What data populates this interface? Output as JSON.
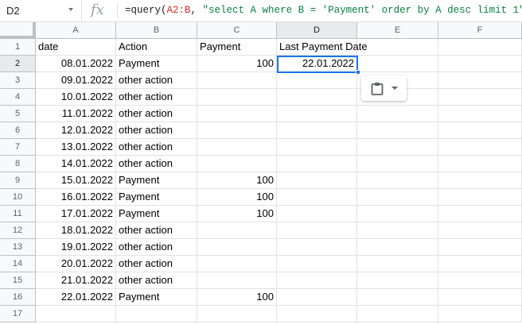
{
  "formula_bar": {
    "cell_ref": "D2",
    "fx_label": "fx",
    "formula_prefix": "=query(",
    "formula_range": "A2:B",
    "formula_sep": ", ",
    "formula_string": "\"select A where B = 'Payment' order by A desc limit 1\"",
    "formula_suffix": ")"
  },
  "columns": [
    "A",
    "B",
    "C",
    "D",
    "E",
    "F"
  ],
  "selected_column": "D",
  "selected_row": 2,
  "rows": [
    {
      "n": "1",
      "a": "date",
      "b": "Action",
      "c": "Payment",
      "d": "Last Payment Date"
    },
    {
      "n": "2",
      "a": "08.01.2022",
      "b": "Payment",
      "c": "100",
      "d": "22.01.2022"
    },
    {
      "n": "3",
      "a": "09.01.2022",
      "b": "other action",
      "c": "",
      "d": ""
    },
    {
      "n": "4",
      "a": "10.01.2022",
      "b": "other action",
      "c": "",
      "d": ""
    },
    {
      "n": "5",
      "a": "11.01.2022",
      "b": "other action",
      "c": "",
      "d": ""
    },
    {
      "n": "6",
      "a": "12.01.2022",
      "b": "other action",
      "c": "",
      "d": ""
    },
    {
      "n": "7",
      "a": "13.01.2022",
      "b": "other action",
      "c": "",
      "d": ""
    },
    {
      "n": "8",
      "a": "14.01.2022",
      "b": "other action",
      "c": "",
      "d": ""
    },
    {
      "n": "9",
      "a": "15.01.2022",
      "b": "Payment",
      "c": "100",
      "d": ""
    },
    {
      "n": "10",
      "a": "16.01.2022",
      "b": "Payment",
      "c": "100",
      "d": ""
    },
    {
      "n": "11",
      "a": "17.01.2022",
      "b": "Payment",
      "c": "100",
      "d": ""
    },
    {
      "n": "12",
      "a": "18.01.2022",
      "b": "other action",
      "c": "",
      "d": ""
    },
    {
      "n": "13",
      "a": "19.01.2022",
      "b": "other action",
      "c": "",
      "d": ""
    },
    {
      "n": "14",
      "a": "20.01.2022",
      "b": "other action",
      "c": "",
      "d": ""
    },
    {
      "n": "15",
      "a": "21.01.2022",
      "b": "other action",
      "c": "",
      "d": ""
    },
    {
      "n": "16",
      "a": "22.01.2022",
      "b": "Payment",
      "c": "100",
      "d": ""
    },
    {
      "n": "17",
      "a": "",
      "b": "",
      "c": "",
      "d": ""
    }
  ],
  "paste_popup": {
    "icon": "clipboard-icon",
    "menu_icon": "dropdown-arrow-icon"
  },
  "colors": {
    "selection": "#1a73e8",
    "header_bg": "#f8f9fa",
    "gridline": "#e2e2e2"
  }
}
